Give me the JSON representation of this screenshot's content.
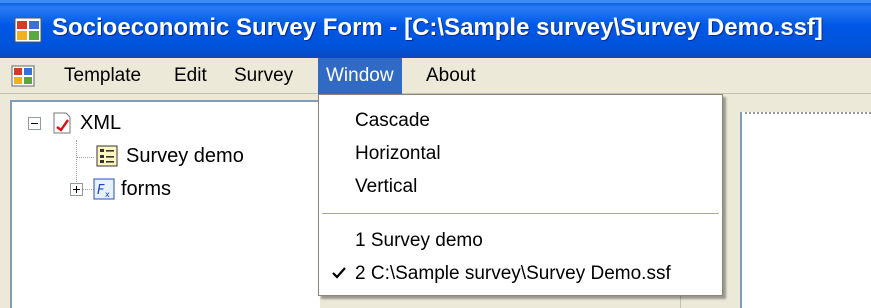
{
  "window": {
    "title": "Socioeconomic Survey Form - [C:\\Sample survey\\Survey Demo.ssf]",
    "icon": "app-icon"
  },
  "menubar": {
    "icon": "app-icon",
    "items": [
      {
        "label": "Template"
      },
      {
        "label": "Edit"
      },
      {
        "label": "Survey"
      },
      {
        "label": "Window",
        "active": true
      },
      {
        "label": "About"
      }
    ]
  },
  "tree": {
    "root": {
      "label": "XML",
      "icon": "xml-document-icon",
      "expanded": true
    },
    "children": [
      {
        "label": "Survey demo",
        "icon": "form-list-icon"
      },
      {
        "label": "forms",
        "icon": "forms-folder-icon",
        "expanded": false
      }
    ]
  },
  "window_menu": {
    "items": [
      {
        "label": "Cascade"
      },
      {
        "label": "Horizontal"
      },
      {
        "label": "Vertical"
      }
    ],
    "windows": [
      {
        "label": "1 Survey demo",
        "checked": false
      },
      {
        "label": "2 C:\\Sample survey\\Survey Demo.ssf",
        "checked": true
      }
    ]
  },
  "colors": {
    "titlebar": "#0054e3",
    "menu_highlight": "#316ac5",
    "window_bg": "#ece9d8"
  }
}
